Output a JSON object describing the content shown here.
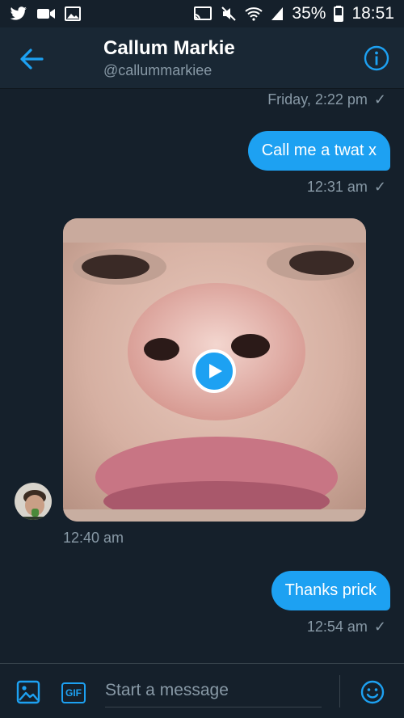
{
  "status_bar": {
    "battery": "35%",
    "time": "18:51",
    "left_icons": [
      "twitter-icon",
      "video-icon",
      "image-icon"
    ],
    "right_icons": [
      "cast-icon",
      "mute-icon",
      "wifi-icon",
      "signal-icon",
      "battery-icon"
    ]
  },
  "header": {
    "name": "Callum Markie",
    "handle": "@callummarkiee",
    "back_icon": "back-arrow-icon",
    "info_icon": "info-icon"
  },
  "messages": [
    {
      "timestamp": "Friday, 2:22 pm",
      "read": "✓"
    },
    {
      "type": "outgoing",
      "text": "Call me a twat x",
      "timestamp": "12:31 am",
      "read": "✓"
    },
    {
      "type": "incoming-video",
      "timestamp": "12:40 am"
    },
    {
      "type": "outgoing",
      "text": "Thanks prick",
      "timestamp": "12:54 am",
      "read": "✓"
    }
  ],
  "composer": {
    "placeholder": "Start a message",
    "gif_label": "GIF"
  },
  "colors": {
    "background": "#15202b",
    "header": "#192734",
    "accent": "#1da1f2",
    "muted_text": "#8899a6"
  }
}
